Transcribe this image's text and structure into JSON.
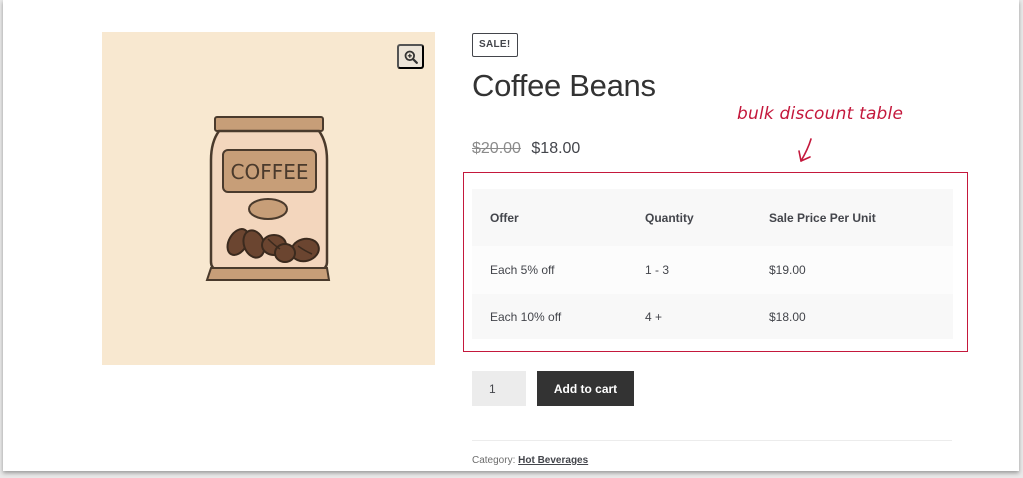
{
  "product": {
    "sale_badge": "SALE!",
    "title": "Coffee Beans",
    "old_price": "$20.00",
    "new_price": "$18.00",
    "image_label": "COFFEE"
  },
  "annotation": {
    "text": "bulk discount table",
    "arrow": "↙"
  },
  "bulk_table": {
    "headers": [
      "Offer",
      "Quantity",
      "Sale Price Per Unit"
    ],
    "rows": [
      [
        "Each 5% off",
        "1 - 3",
        "$19.00"
      ],
      [
        "Each 10% off",
        "4 +",
        "$18.00"
      ]
    ]
  },
  "cart": {
    "quantity": "1",
    "add_label": "Add to cart"
  },
  "meta": {
    "category_label": "Category:",
    "category_value": "Hot Beverages"
  },
  "colors": {
    "image_bg": "#f8e8d0",
    "annotation": "#c4183c",
    "button_bg": "#333333"
  },
  "icons": {
    "zoom": "zoom-in-icon"
  }
}
